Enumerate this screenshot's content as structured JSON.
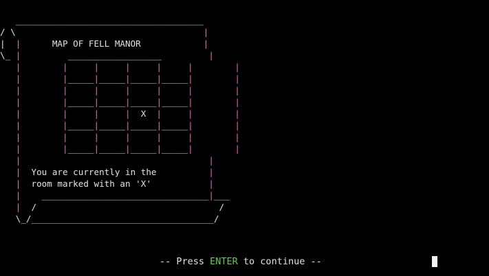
{
  "scroll": {
    "title": "MAP OF FELL MANOR",
    "message_line_1": "You are currently in the",
    "message_line_2": "room marked with an 'X'"
  },
  "map": {
    "rows": 5,
    "cols": 4,
    "marker": "X",
    "marker_row": 3,
    "marker_col": 3
  },
  "prompt": {
    "prefix": "-- Press ",
    "key": "ENTER",
    "suffix": " to continue --"
  },
  "colors": {
    "background": "#000000",
    "text": "#e2e2e2",
    "grid_lines": "#e06bb6",
    "key_highlight": "#58d63c"
  }
}
